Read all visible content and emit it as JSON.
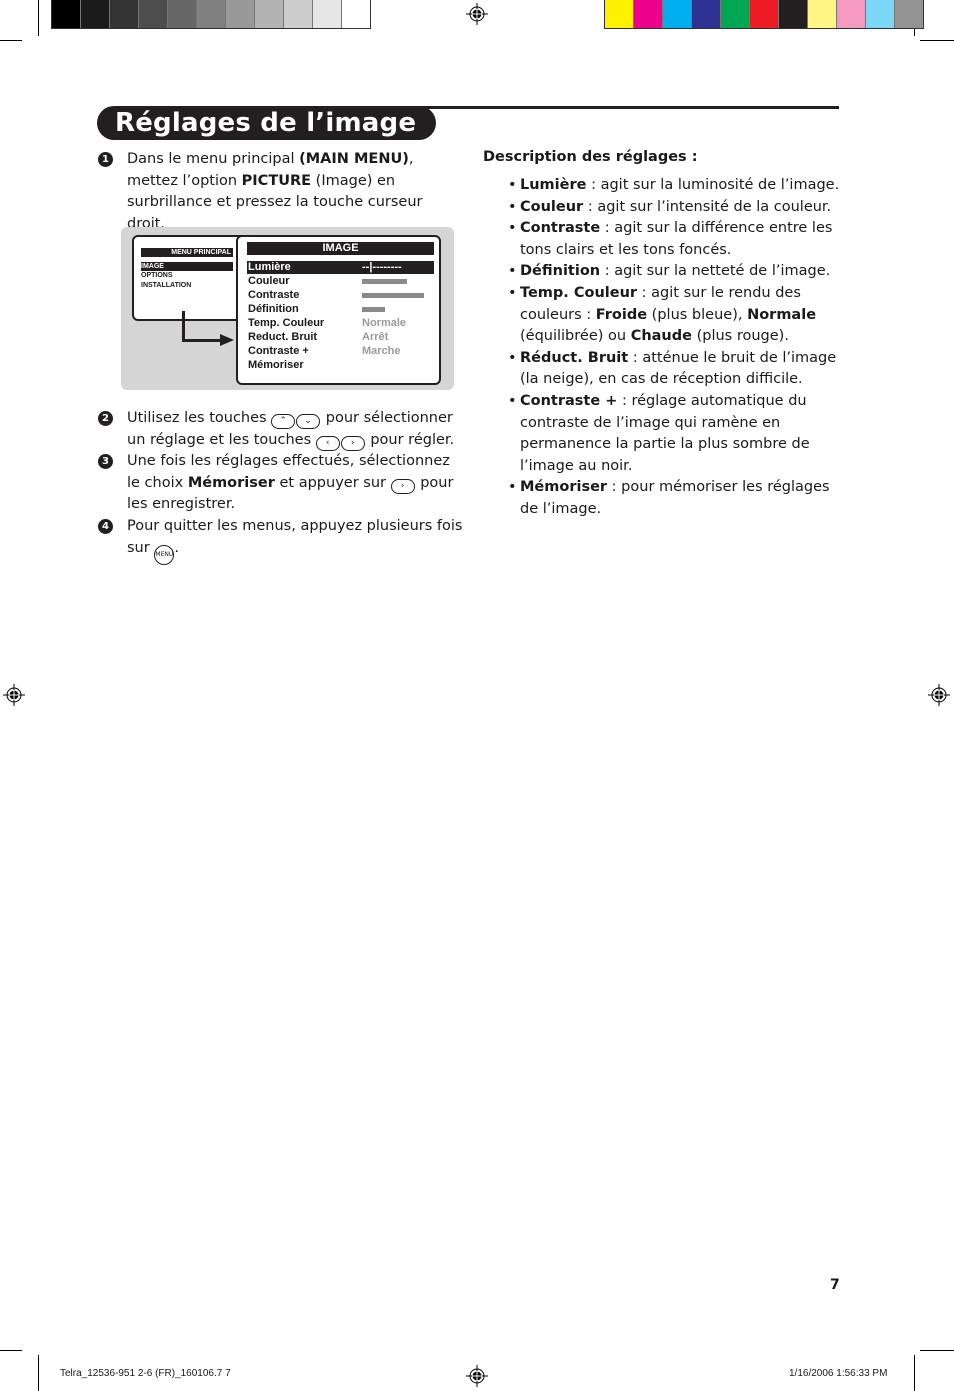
{
  "print_marks": {
    "grayscale_swatches": [
      "#000000",
      "#1b1b1b",
      "#333333",
      "#4d4d4d",
      "#666666",
      "#808080",
      "#999999",
      "#b3b3b3",
      "#cccccc",
      "#e6e6e6",
      "#ffffff"
    ],
    "color_swatches": [
      "#fff200",
      "#ec008c",
      "#00aeef",
      "#2e3192",
      "#00a651",
      "#ed1c24",
      "#231f20",
      "#fff685",
      "#f49ac1",
      "#7dd8f7",
      "#939393"
    ]
  },
  "header": {
    "title": "Réglages de l’image"
  },
  "steps": [
    {
      "number": "1",
      "parts": {
        "a": "Dans le menu principal ",
        "b_bold": "(MAIN MENU)",
        "c": ", mettez l’option ",
        "d_bold": "PICTURE",
        "e": " (Image) en surbrillance et pressez la touche curseur droit."
      }
    },
    {
      "number": "2",
      "parts": {
        "a": "Utilisez les touches ",
        "key_up": "⌃",
        "key_down": "⌄",
        "b": " pour sélectionner un réglage et les touches ",
        "key_left": "‹",
        "key_right": "›",
        "c": " pour régler."
      }
    },
    {
      "number": "3",
      "parts": {
        "a": "Une fois les réglages effectués, sélectionnez le choix ",
        "b_bold": "Mémoriser",
        "c": " et appuyer sur ",
        "key_right": "›",
        "d": " pour les enregistrer."
      }
    },
    {
      "number": "4",
      "parts": {
        "a": "Pour quitter les menus, appuyez plusieurs fois sur ",
        "key_menu": "MENU",
        "b": "."
      }
    }
  ],
  "osd": {
    "main_menu": {
      "header": "MENU PRINCIPAL",
      "items": [
        "IMAGE",
        "OPTIONS",
        "INSTALLATION"
      ],
      "selected_index": 0
    },
    "image_menu": {
      "header": "IMAGE",
      "rows": [
        {
          "label": "Lumière",
          "value": "--|--------",
          "selected": true
        },
        {
          "label": "Couleur",
          "bar_level": 0.72
        },
        {
          "label": "Contraste",
          "bar_level": 1.0
        },
        {
          "label": "Définition",
          "bar_level": 0.37
        },
        {
          "label": "Temp. Couleur",
          "value": "Normale"
        },
        {
          "label": "Reduct. Bruit",
          "value": "Arrêt"
        },
        {
          "label": "Contraste +",
          "value": "Marche"
        },
        {
          "label": "Mémoriser"
        }
      ]
    }
  },
  "description": {
    "heading": "Description des réglages :",
    "items": [
      {
        "term": "Lumière",
        "text": " : agit sur la luminosité de l’image."
      },
      {
        "term": "Couleur",
        "text": " : agit sur l’intensité de la couleur."
      },
      {
        "term": "Contraste",
        "text": " : agit sur la différence entre les tons clairs et les tons foncés."
      },
      {
        "term": "Définition",
        "text": " : agit sur la netteté de l’image."
      },
      {
        "term": "Temp. Couleur",
        "text": " : agit sur le rendu des couleurs : ",
        "opt1": "Froide",
        "opt1_text": " (plus bleue), ",
        "opt2": "Normale",
        "opt2_text": " (équilibrée) ou ",
        "opt3": "Chaude",
        "opt3_text": " (plus rouge)."
      },
      {
        "term": "Réduct. Bruit",
        "text": " : atténue le bruit de l’image (la neige), en cas de réception difficile."
      },
      {
        "term": "Contraste +",
        "text": " : réglage automatique du contraste de l’image qui ramène en permanence la partie la plus sombre de l’image au noir."
      },
      {
        "term": "Mémoriser",
        "text": " : pour mémoriser les réglages de l’image."
      }
    ],
    "bullet": "•"
  },
  "page_number": "7",
  "footer": {
    "file": "Telra_12536-951 2-6 (FR)_160106.7   7",
    "timestamp": "1/16/2006   1:56:33 PM"
  }
}
